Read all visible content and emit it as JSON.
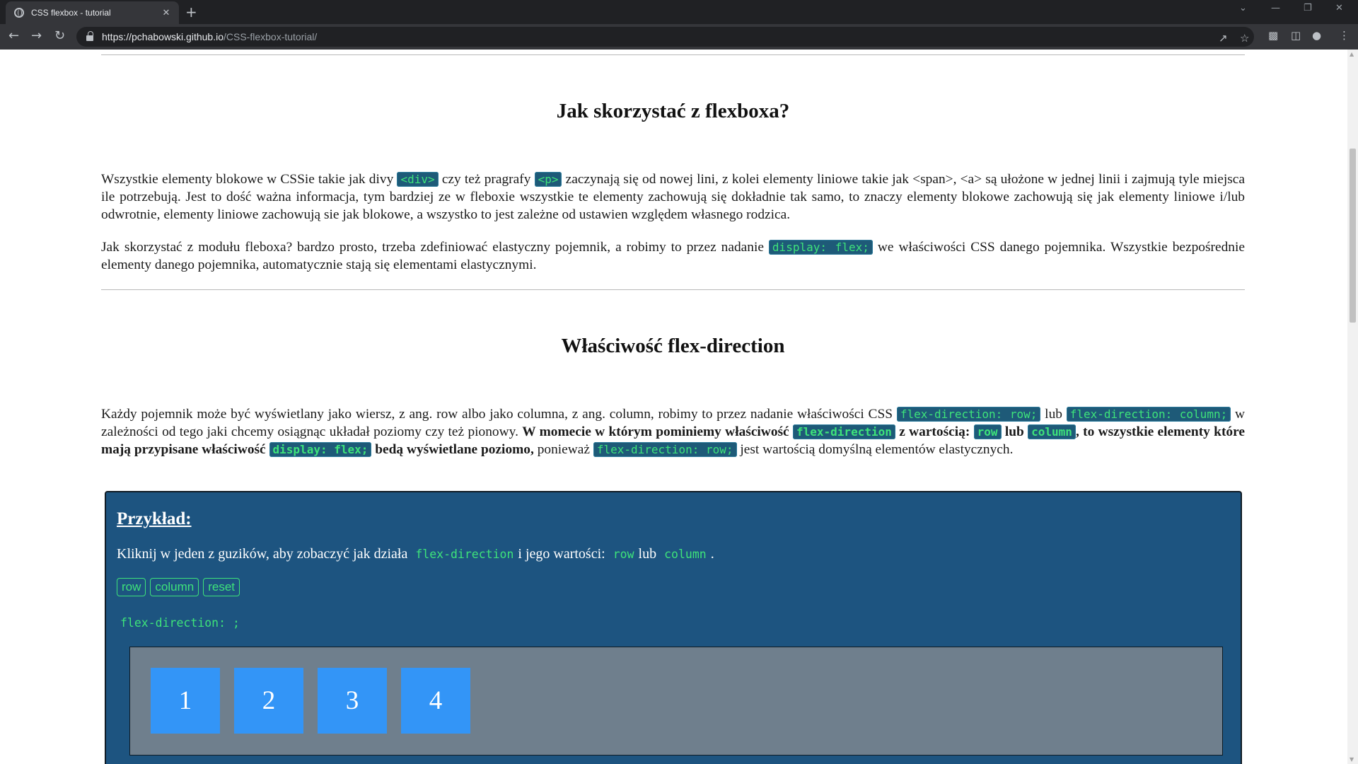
{
  "browser": {
    "tab_title": "CSS flexbox - tutorial",
    "tab_close": "✕",
    "new_tab": "+",
    "url_host": "https://pchabowski.github.io",
    "url_path": "/CSS-flexbox-tutorial/",
    "window_controls": [
      "⌄",
      "—",
      "❐",
      "✕"
    ],
    "toolbar_icons": [
      "share-icon",
      "star-icon",
      "extensions-icon",
      "sidebar-icon",
      "profile-icon",
      "menu-icon"
    ]
  },
  "section1": {
    "heading": "Jak skorzystać z flexboxa?",
    "p1": {
      "t1": "Wszystkie elementy blokowe w CSSie takie jak divy ",
      "c1": "<div>",
      "t2": " czy też pragrafy ",
      "c2": "<p>",
      "t3": " zaczynają się od nowej lini, z kolei elementy liniowe takie jak <span>, <a> są ułożone w jednej linii i zajmują tyle miejsca ile potrzebują. Jest to dość ważna informacja, tym bardziej ze w fleboxie wszystkie te elementy zachowują się dokładnie tak samo, to znaczy elementy blokowe zachowują się jak elementy liniowe i/lub odwrotnie, elementy liniowe zachowują sie jak blokowe, a wszystko to jest zależne od ustawien względem własnego rodzica."
    },
    "p2": {
      "t1": "Jak skorzystać z modułu fleboxa? bardzo prosto, trzeba zdefiniować elastyczny pojemnik, a robimy to przez nadanie ",
      "c1": "display: flex;",
      "t2": " we właściwości CSS danego pojemnika. Wszystkie bezpośrednie elementy danego pojemnika, automatycznie stają się elementami elastycznymi."
    }
  },
  "section2": {
    "heading": "Właściwość flex-direction",
    "p3": {
      "t1": "Każdy pojemnik może być wyświetlany jako wiersz, z ang. row albo jako columna, z ang. column, robimy to przez nadanie właściwości CSS ",
      "c1": "flex-direction: row;",
      "t2": " lub ",
      "c2": "flex-direction: column;",
      "t3": " w zależności od tego jaki chcemy osiągnąc układał poziomy czy też pionowy. ",
      "b1": "W momecie w którym pominiemy właściwość ",
      "bc1": "flex-direction",
      "b2": " z wartością: ",
      "bc2": "row",
      "b3": " lub ",
      "bc3": "column",
      "b4": ", to wszystkie elementy które mają przypisane właściwość ",
      "bc4": "display: flex;",
      "b5": " bedą wyświetlane poziomo,",
      "t4": " ponieważ ",
      "c3": "flex-direction: row;",
      "t5": " jest wartością domyślną elementów elastycznych."
    }
  },
  "example": {
    "title": "Przykład:",
    "desc_t1": "Kliknij w jeden z guzików, aby zobaczyć jak działa",
    "desc_c1": "flex-direction",
    "desc_t2": "i jego wartości:",
    "desc_c2": "row",
    "desc_t3": "lub",
    "desc_c3": "column",
    "desc_t4": ".",
    "buttons": [
      "row",
      "column",
      "reset"
    ],
    "css_output": "flex-direction: ;",
    "items": [
      "1",
      "2",
      "3",
      "4"
    ]
  },
  "colors": {
    "code_bg": "#1e5a78",
    "code_text": "#3ee37a",
    "example_bg": "#1d5480",
    "flex_area_bg": "#6f7f8d",
    "flex_item_bg": "#3395f7"
  }
}
